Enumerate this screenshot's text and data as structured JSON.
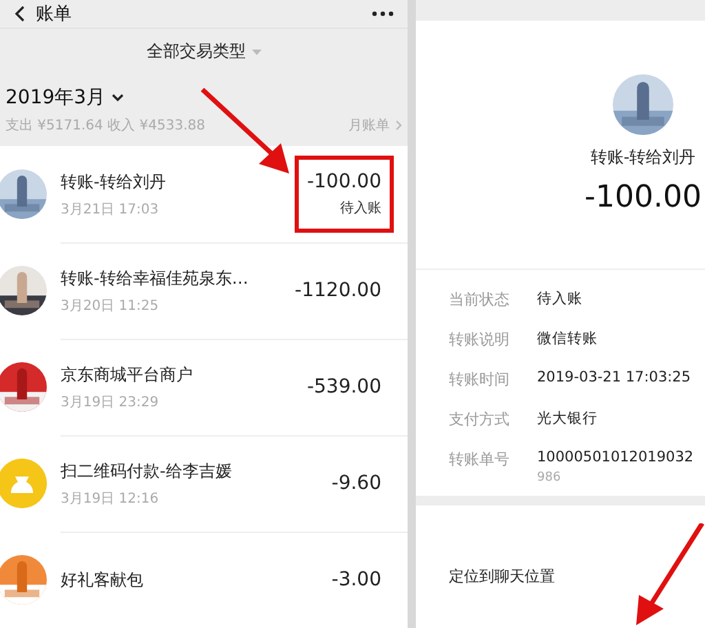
{
  "bill": {
    "title": "账单",
    "filter": "全部交易类型",
    "month": "2019年3月",
    "summary": "支出 ¥5171.64 收入 ¥4533.88",
    "monthly_bill": "月账单",
    "transactions": [
      {
        "kind": "picture",
        "title": "转账-转给刘丹",
        "time": "3月21日 17:03",
        "amount": "-100.00",
        "status": "待入账",
        "highlighted": true
      },
      {
        "kind": "picture",
        "title": "转账-转给幸福佳苑泉东…",
        "time": "3月20日 11:25",
        "amount": "-1120.00",
        "highlighted": false
      },
      {
        "kind": "picture",
        "title": "京东商城平台商户",
        "time": "3月19日 23:29",
        "amount": "-539.00",
        "highlighted": false
      },
      {
        "kind": "icon",
        "title": "扫二维码付款-给李吉媛",
        "time": "3月19日 12:16",
        "amount": "-9.60",
        "highlighted": false
      },
      {
        "kind": "picture",
        "title": "好礼客献包",
        "amount": "-3.00",
        "highlighted": false
      }
    ]
  },
  "detail": {
    "name": "转账-转给刘丹",
    "amount": "-100.00",
    "fields": [
      {
        "label": "当前状态",
        "value": "待入账"
      },
      {
        "label": "转账说明",
        "value": "微信转账"
      },
      {
        "label": "转账时间",
        "value": "2019-03-21 17:03:25"
      },
      {
        "label": "支付方式",
        "value": "光大银行"
      },
      {
        "label": "转账单号",
        "value": "10000501012019032",
        "extra": "986"
      }
    ],
    "locate": "定位到聊天位置"
  }
}
